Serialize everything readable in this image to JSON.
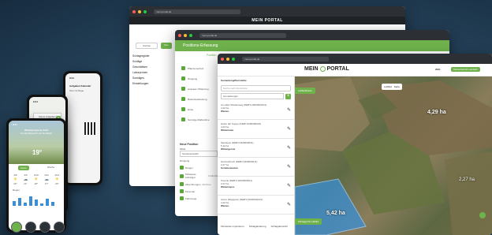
{
  "back_window": {
    "url": "mein-portal.de",
    "brand": "MEIN PORTAL",
    "search_placeholder": "Suchen",
    "add_button": "Neu",
    "sidebar_items": [
      "Schlagregister",
      "Schläge",
      "Geschäftsen",
      "Laborproben",
      "Sonstiges",
      "Einstellungen"
    ]
  },
  "middle_window": {
    "url": "mein-portal.de",
    "header_title": "Positions-Erfassung",
    "subheader": "Position",
    "rows": [
      {
        "check": true,
        "text": "Pflanzenschutz"
      },
      {
        "check": true,
        "text": "Düngung"
      },
      {
        "check": true,
        "text": "Aussaat / Pflanzung"
      },
      {
        "check": true,
        "text": "Bodenbearbeitung"
      },
      {
        "check": true,
        "text": "Ernte"
      },
      {
        "check": true,
        "text": "Sonstige Maßnahme"
      }
    ],
    "new_position_title": "Neue Position",
    "new_position_label": "Mittel",
    "new_position_value": "Sonderauswahl",
    "mittel_label": "Düngung",
    "bottom_items": [
      {
        "text": "Dünger",
        "sub": ""
      },
      {
        "text": "Schlepper, Anhänger",
        "sub": "Kraftstoff"
      },
      {
        "text": "Abrechnungen",
        "sub": "Mehrere"
      },
      {
        "text": "Personal",
        "sub": ""
      },
      {
        "text": "Fahrzeuge",
        "sub": ""
      }
    ]
  },
  "front_window": {
    "url": "mein-portal.de",
    "brand_prefix": "MEIN",
    "brand_suffix": "PORTAL",
    "year": "2021",
    "user": "Musterbetrieb Landwirt",
    "sidebar_title": "Gemarkung/Flurstücke",
    "search_placeholder": "Suche nach Flurstücke",
    "filter_label": "Gemarkungen",
    "fields": [
      {
        "name": "Am alten Weidenweg",
        "id": "DEBYLI0000002211",
        "area": "4,22 ha",
        "crop": "Weizen"
      },
      {
        "name": "Hinter der Kuppe",
        "id": "DEBYLI000000022",
        "area": "4,23 ha",
        "crop": "Wintermais"
      },
      {
        "name": "Sanwiese",
        "id": "DEBYLI000000031",
        "area": "5,12 ha",
        "crop": "Wintergerste"
      },
      {
        "name": "Hammerbuch",
        "id": "DEBYLI000000211",
        "area": "2,27 ha",
        "crop": "Sommerweizen"
      },
      {
        "name": "Kreuzle",
        "id": "DEBYLI0000000211",
        "area": "2,27 ha",
        "crop": "Winterrapss"
      },
      {
        "name": "Anner Wegspann",
        "id": "DEBYLI0000002221",
        "area": "4,22 ha",
        "crop": "Weizen"
      }
    ],
    "footer_links": [
      "Flurstücke importieren",
      "Schlagänderung",
      "Schlagübersicht"
    ],
    "map_label_1": "4,29 ha",
    "map_label_2": "2,27 ha",
    "map_label_3": "5,42 ha",
    "map_toggle_1": "Luftbild",
    "map_toggle_2": "Karte",
    "area_badge": "Luftbild/Karte",
    "map_bottom_badge": "Schlagsicht Luftbild"
  },
  "phones": {
    "p1": {
      "time": "9:41",
      "title": "Aufgaben Kalender",
      "subtitle": "Mein Schläge"
    },
    "p2": {
      "time": "9:41",
      "button": "Meine Aufgaben",
      "count": "8"
    },
    "p3": {
      "time": "9:41",
      "weather_title": "Wetterprognose Feld",
      "weather_sub": "Grünlandbereich am Dorfbach",
      "temp_now": "19°",
      "days": [
        "4/8",
        "4/9",
        "4/10",
        "4/11",
        "4/12"
      ],
      "temps": [
        "19°",
        "21°",
        "18°",
        "17°",
        "20°"
      ],
      "tab1": "Heute",
      "tab2": "Woche",
      "rain_label": "Regen"
    }
  },
  "colors": {
    "accent_green": "#6fb24c",
    "chrome": "#2c2f33",
    "field_blue": "#3a8fd6"
  }
}
